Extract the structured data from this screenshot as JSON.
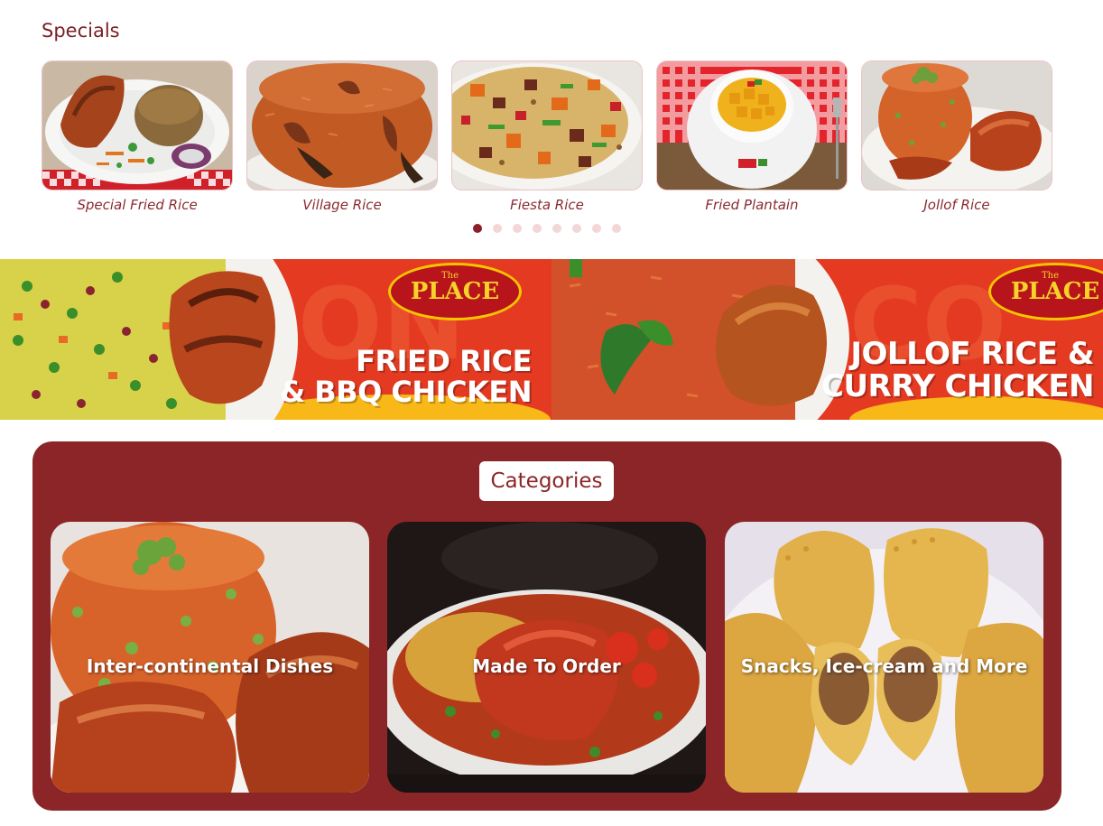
{
  "specials": {
    "title": "Specials",
    "items": [
      {
        "name": "Special Fried Rice",
        "icon": "special-fried-rice-photo"
      },
      {
        "name": "Village Rice",
        "icon": "village-rice-photo"
      },
      {
        "name": "Fiesta Rice",
        "icon": "fiesta-rice-photo"
      },
      {
        "name": "Fried Plantain",
        "icon": "fried-plantain-photo"
      },
      {
        "name": "Jollof Rice",
        "icon": "jollof-rice-photo"
      }
    ],
    "pagination": {
      "total": 8,
      "active": 1
    }
  },
  "banner": {
    "left": {
      "logo_small": "The",
      "logo": "PLACE",
      "line1": "FRIED RICE",
      "line2": "& BBQ CHICKEN"
    },
    "right": {
      "logo_small": "The",
      "logo": "PLACE",
      "line1": "JOLLOF RICE &",
      "line2": "CURRY CHICKEN"
    }
  },
  "categories": {
    "title": "Categories",
    "items": [
      {
        "label": "Inter-continental Dishes",
        "icon": "jollof-chicken-photo"
      },
      {
        "label": "Made To Order",
        "icon": "stew-bowl-photo"
      },
      {
        "label": "Snacks, Ice-cream and More",
        "icon": "meat-pie-photo"
      }
    ]
  },
  "colors": {
    "brand": "#8c2527",
    "dot_inactive": "#f2d6d8",
    "banner_red": "#e53a22",
    "logo_gold": "#f7c500"
  }
}
